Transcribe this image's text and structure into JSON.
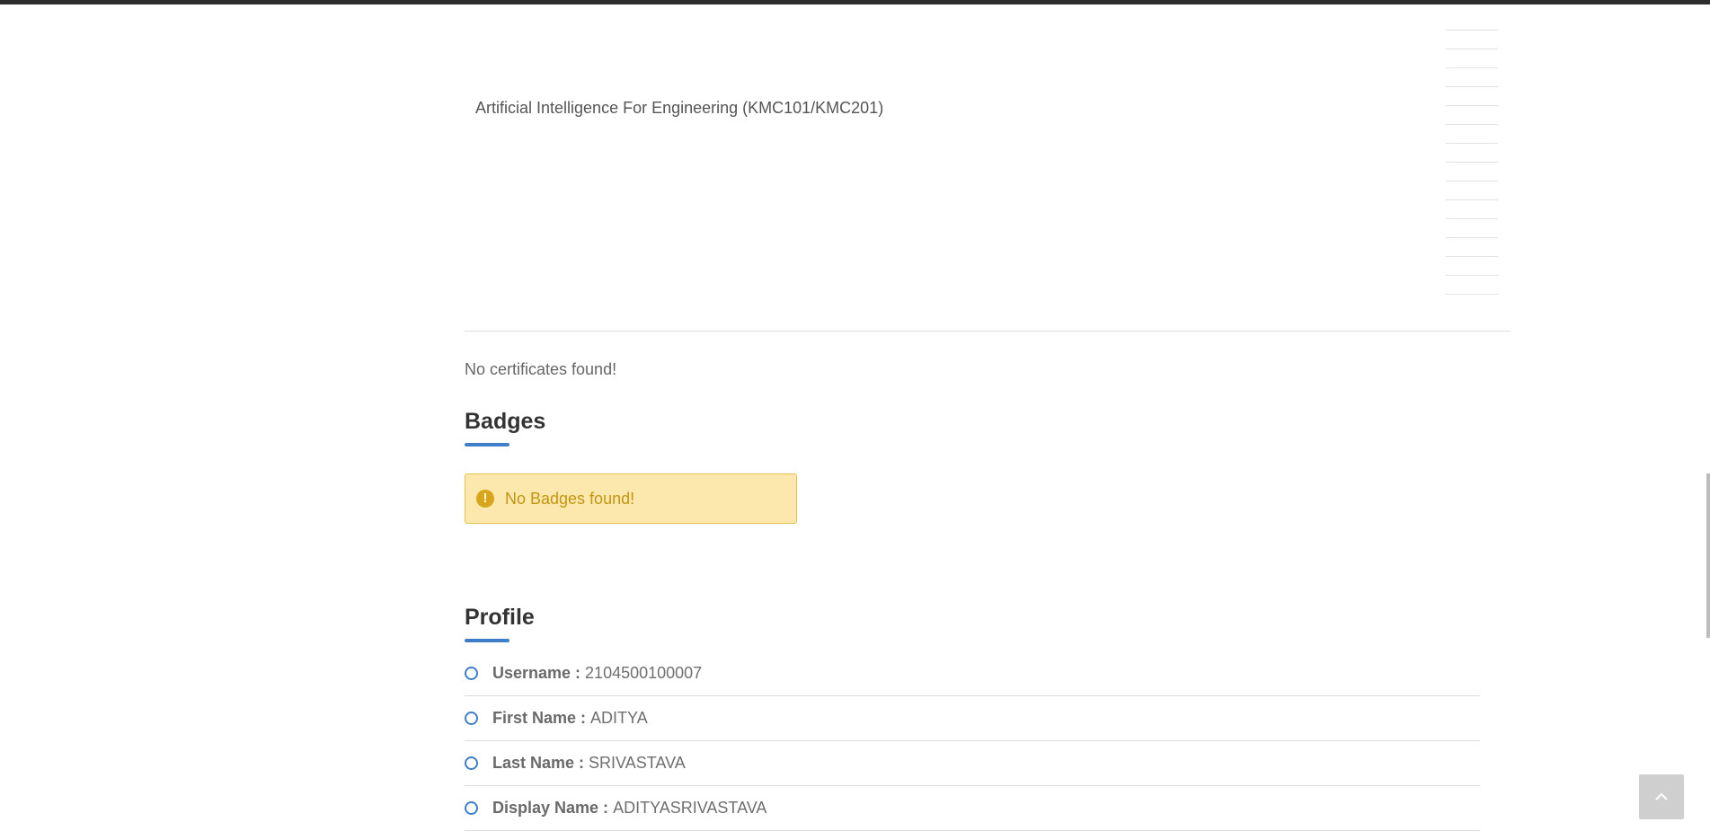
{
  "courses": {
    "title": "Artificial Intelligence For Engineering (KMC101/KMC201)"
  },
  "certificates": {
    "empty_message": "No certificates found!"
  },
  "badges": {
    "heading": "Badges",
    "empty_message": "No Badges found!",
    "alert_icon_glyph": "!",
    "alert_icon": "exclamation-circle-icon"
  },
  "profile": {
    "heading": "Profile",
    "fields": [
      {
        "label": "Username :",
        "value": "2104500100007"
      },
      {
        "label": "First Name :",
        "value": "ADITYA"
      },
      {
        "label": "Last Name :",
        "value": "SRIVASTAVA"
      },
      {
        "label": "Display Name :",
        "value": "ADITYASRIVASTAVA"
      }
    ],
    "bullet_icon": "circle-outline-icon"
  },
  "controls": {
    "back_to_top_icon": "chevron-up-icon"
  },
  "colors": {
    "accent": "#3f7ec9",
    "warning_bg": "#fce8ac",
    "warning_text": "#c29512"
  }
}
